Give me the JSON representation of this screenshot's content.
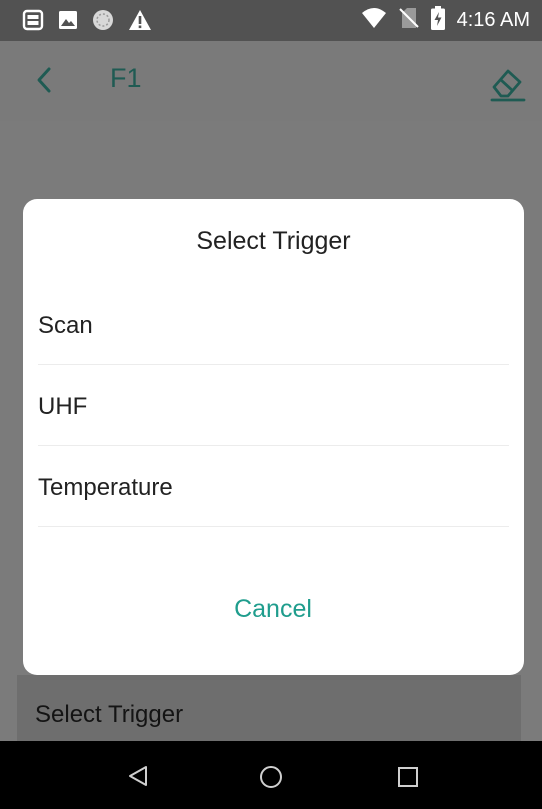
{
  "status_bar": {
    "time": "4:16 AM",
    "icons": [
      "scanner-icon",
      "image-icon",
      "sync-icon",
      "warning-icon",
      "wifi-icon",
      "no-sim-icon",
      "battery-charging-icon"
    ]
  },
  "app_bar": {
    "title": "F1",
    "back_icon": "back-icon",
    "action_icon": "eraser-icon"
  },
  "background": {
    "card_label": "Select Trigger"
  },
  "dialog": {
    "title": "Select Trigger",
    "options": [
      {
        "label": "Scan"
      },
      {
        "label": "UHF"
      },
      {
        "label": "Temperature"
      }
    ],
    "cancel_label": "Cancel"
  },
  "nav_bar": {
    "icons": [
      "nav-back-icon",
      "nav-home-icon",
      "nav-recents-icon"
    ]
  },
  "colors": {
    "accent": "#1f9d8d",
    "title_color": "#1f5b53",
    "scrim_status": "#525252",
    "scrim_appbar": "#7a7a7a",
    "scrim_content": "#7b7b7b",
    "nav_bar": "#000000"
  }
}
